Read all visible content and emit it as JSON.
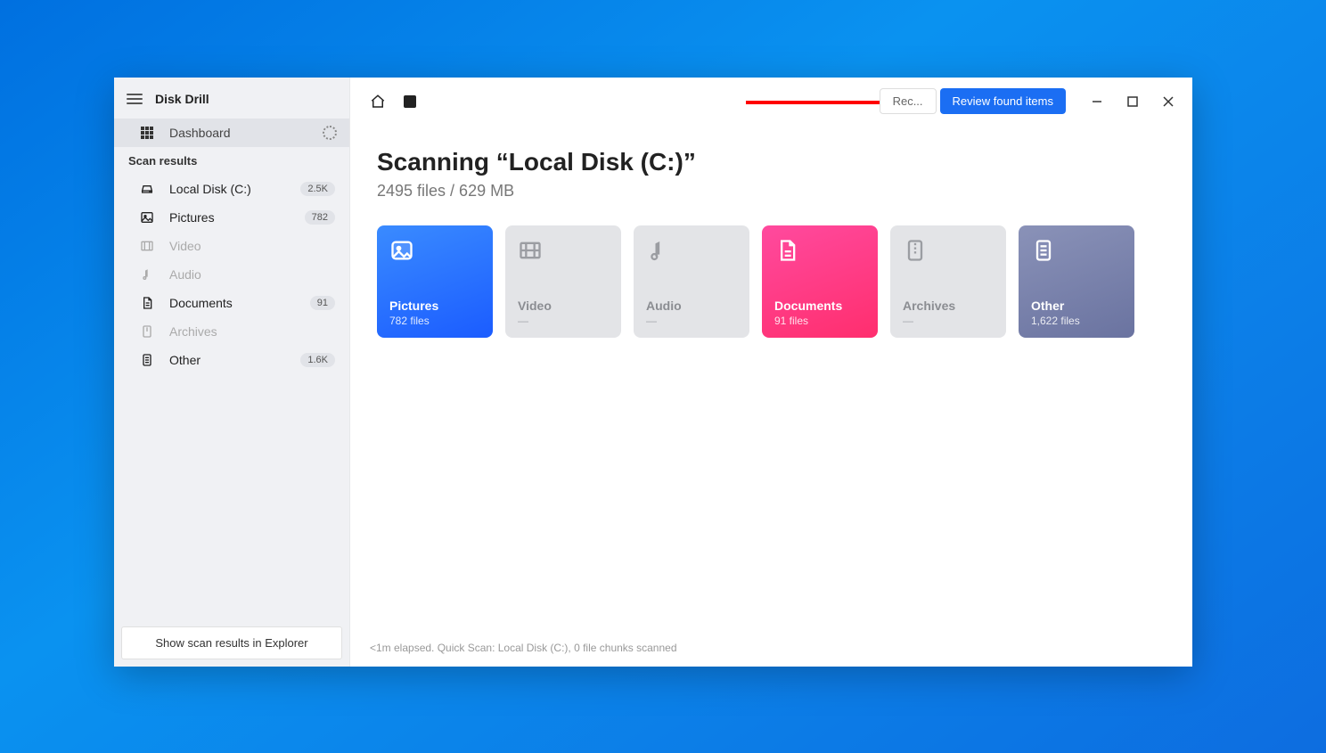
{
  "app": {
    "title": "Disk Drill"
  },
  "sidebar": {
    "dashboard": "Dashboard",
    "section_label": "Scan results",
    "items": [
      {
        "icon": "disk",
        "label": "Local Disk (C:)",
        "badge": "2.5K",
        "strong": true
      },
      {
        "icon": "picture",
        "label": "Pictures",
        "badge": "782",
        "strong": true
      },
      {
        "icon": "video",
        "label": "Video",
        "badge": "",
        "muted": true
      },
      {
        "icon": "audio",
        "label": "Audio",
        "badge": "",
        "muted": true
      },
      {
        "icon": "document",
        "label": "Documents",
        "badge": "91",
        "strong": true
      },
      {
        "icon": "archive",
        "label": "Archives",
        "badge": "",
        "muted": true
      },
      {
        "icon": "other",
        "label": "Other",
        "badge": "1.6K",
        "strong": true
      }
    ],
    "footer_button": "Show scan results in Explorer"
  },
  "toolbar": {
    "ghost_button": "Rec...",
    "primary_button": "Review found items"
  },
  "scan": {
    "title": "Scanning “Local Disk (C:)”",
    "subtitle": "2495 files / 629 MB"
  },
  "cards": [
    {
      "kind": "pictures",
      "title": "Pictures",
      "sub": "782 files"
    },
    {
      "kind": "video",
      "title": "Video",
      "sub": "—"
    },
    {
      "kind": "audio",
      "title": "Audio",
      "sub": "—"
    },
    {
      "kind": "documents",
      "title": "Documents",
      "sub": "91 files"
    },
    {
      "kind": "archives",
      "title": "Archives",
      "sub": "—"
    },
    {
      "kind": "other",
      "title": "Other",
      "sub": "1,622 files"
    }
  ],
  "status": "<1m elapsed. Quick Scan: Local Disk (C:), 0 file chunks scanned"
}
